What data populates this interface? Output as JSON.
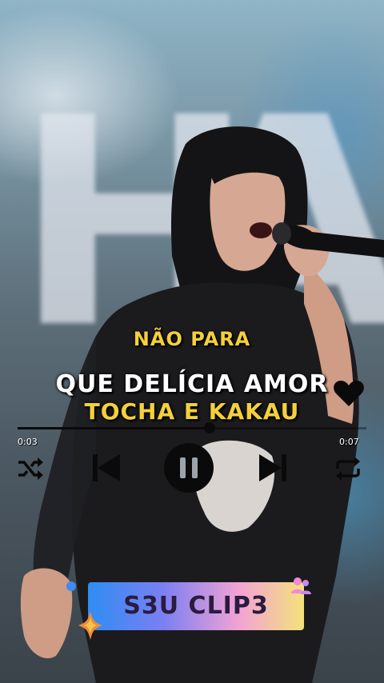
{
  "player": {
    "subtitle": "NÃO PARA",
    "song_title": "QUE DELÍCIA AMOR",
    "artist": "TOCHA E KAKAU",
    "progress_fraction": 0.55,
    "time_elapsed": "0:03",
    "time_total": "0:07",
    "controls": {
      "shuffle": "shuffle-icon",
      "previous": "previous-icon",
      "pause": "pause-icon",
      "next": "next-icon",
      "repeat": "repeat-icon",
      "favorite": "heart-icon"
    }
  },
  "banner": {
    "label": "S3U CLIP3"
  },
  "colors": {
    "highlight_text": "#f4d03a",
    "primary_text": "#ffffff",
    "controls": "#0a0a0a"
  }
}
